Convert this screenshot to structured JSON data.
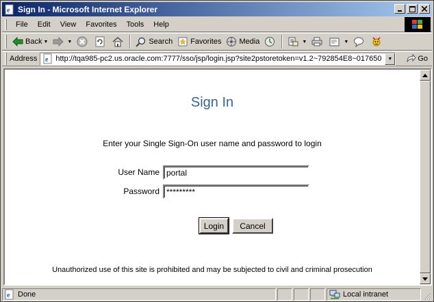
{
  "window": {
    "title": "Sign In - Microsoft Internet Explorer"
  },
  "menu": {
    "items": [
      "File",
      "Edit",
      "View",
      "Favorites",
      "Tools",
      "Help"
    ]
  },
  "toolbar": {
    "back_label": "Back",
    "search_label": "Search",
    "favorites_label": "Favorites",
    "media_label": "Media"
  },
  "address": {
    "label": "Address",
    "url": "http://tqa985-pc2.us.oracle.com:7777/sso/jsp/login.jsp?site2pstoretoken=v1.2~792854E8~017650",
    "go_label": "Go"
  },
  "page": {
    "title": "Sign In",
    "instruction": "Enter your Single Sign-On user name and password to login",
    "username_label": "User Name",
    "username_value": "portal",
    "password_label": "Password",
    "password_value": "*********",
    "login_label": "Login",
    "cancel_label": "Cancel",
    "disclaimer": "Unauthorized use of this site is prohibited and may be subjected to civil and criminal prosecution"
  },
  "status": {
    "text": "Done",
    "zone": "Local intranet"
  },
  "colors": {
    "title_blue": "#336699",
    "titlebar_start": "#0a246a",
    "titlebar_end": "#a6caf0"
  }
}
